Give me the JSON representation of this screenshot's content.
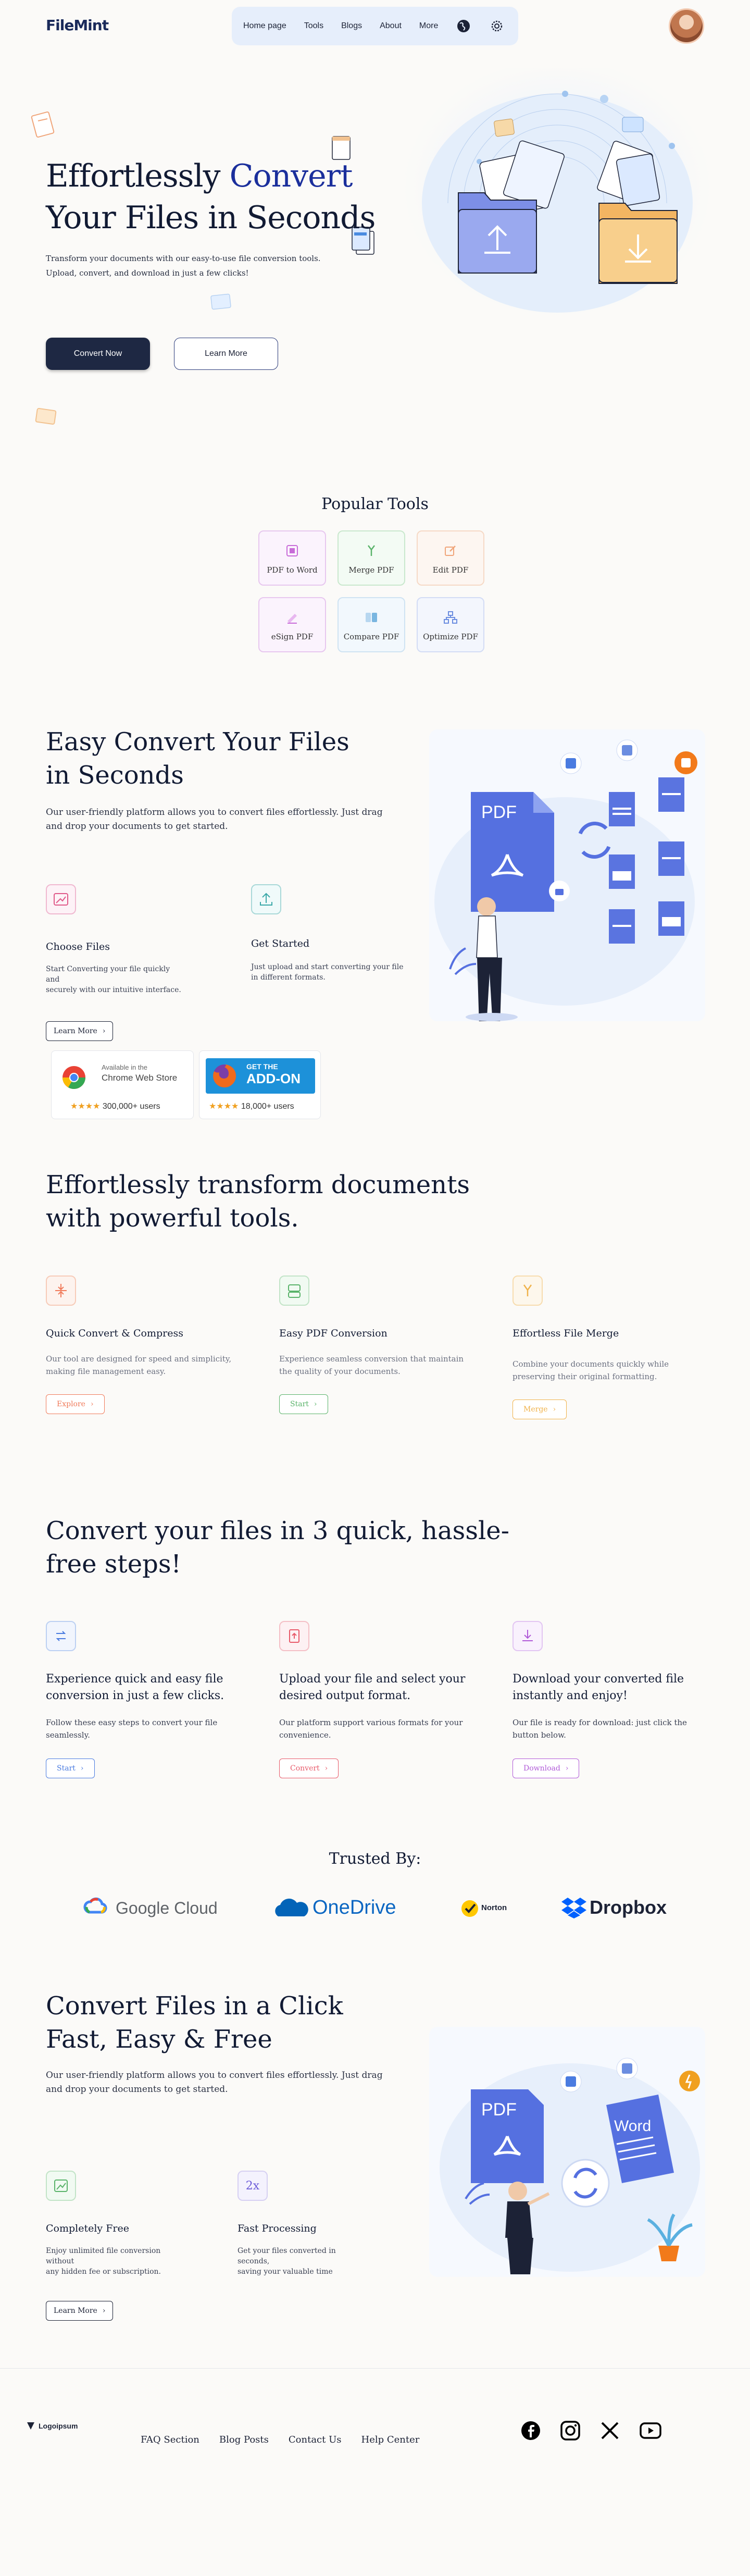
{
  "brand": {
    "name": "FileMint"
  },
  "nav": {
    "links": [
      "Home page",
      "Tools",
      "Blogs",
      "About",
      "More"
    ],
    "icons": [
      "globe-icon",
      "gear-icon"
    ]
  },
  "hero": {
    "title_line1_a": "Effortlessly ",
    "title_line1_b": "Convert",
    "title_line2": "Your Files in Seconds",
    "desc_line1": "Transform your documents with our easy-to-use file conversion tools.",
    "desc_line2": "Upload, convert, and download in just a few clicks!",
    "primary_button": "Convert Now",
    "secondary_button": "Learn More"
  },
  "popular_tools": {
    "title": "Popular Tools",
    "items": [
      {
        "label": "PDF to Word",
        "color": "#c86bd8"
      },
      {
        "label": "Merge PDF",
        "color": "#5ab36a"
      },
      {
        "label": "Edit PDF",
        "color": "#f0a57a"
      },
      {
        "label": "eSign PDF",
        "color": "#c86bd8"
      },
      {
        "label": "Compare PDF",
        "color": "#7ab6e0"
      },
      {
        "label": "Optimize PDF",
        "color": "#6b8de0"
      }
    ]
  },
  "easy_convert": {
    "title_line1": "Easy Convert Your Files",
    "title_line2": "in Seconds",
    "desc_line1": "Our user-friendly platform allows you to convert files effortlessly. Just drag",
    "desc_line2": "and drop your documents to get started.",
    "feature1": {
      "title": "Choose Files",
      "desc_line1": "Start Converting your file quickly",
      "desc_line2": "and",
      "desc_line3": "securely with our intuitive interface."
    },
    "feature2": {
      "title": "Get Started",
      "desc_line1": "Just upload and start converting your file",
      "desc_line2": "in different formats."
    },
    "learn_more": "Learn More",
    "chrome_badge": {
      "line1": "Available in the",
      "line2": "Chrome Web Store",
      "users": "300,000+ users"
    },
    "firefox_badge": {
      "line1": "GET THE",
      "line2": "ADD-ON",
      "users": "18,000+ users"
    },
    "illustration_label": "PDF"
  },
  "transform": {
    "title_line1": "Effortlessly transform documents",
    "title_line2": "with powerful tools.",
    "cards": [
      {
        "title": "Quick Convert & Compress",
        "desc_line1": "Our tool are designed for speed and simplicity,",
        "desc_line2": "making file management easy.",
        "button": "Explore",
        "color": "#f07a5a"
      },
      {
        "title": "Easy PDF Conversion",
        "desc_line1": "Experience seamless conversion that maintain",
        "desc_line2": "the quality of your documents.",
        "button": "Start",
        "color": "#5ab36a"
      },
      {
        "title": "Effortless File Merge",
        "desc_line1": "Combine your documents quickly while",
        "desc_line2": "preserving their original formatting.",
        "button": "Merge",
        "color": "#f0b24a"
      }
    ]
  },
  "steps": {
    "title_line1": "Convert your files in 3 quick, hassle-",
    "title_line2": "free steps!",
    "cards": [
      {
        "title_line1": "Experience quick and easy file",
        "title_line2": "conversion in just a few clicks.",
        "desc_line1": "Follow these easy steps to convert your file",
        "desc_line2": "seamlessly.",
        "button": "Start",
        "color": "#4a7be0"
      },
      {
        "title_line1": "Upload your file and select your",
        "title_line2": "desired output format.",
        "desc_line1": "Our platform support various formats for your",
        "desc_line2": "convenience.",
        "button": "Convert",
        "color": "#e85a6a"
      },
      {
        "title_line1": "Download your converted file",
        "title_line2": "instantly and enjoy!",
        "desc_line1": "Our file is ready for download: just click the",
        "desc_line2": "button below.",
        "button": "Download",
        "color": "#b05ad8"
      }
    ]
  },
  "trusted": {
    "title": "Trusted By:",
    "logos": [
      "Google Cloud",
      "OneDrive",
      "Norton",
      "Dropbox"
    ]
  },
  "click": {
    "title_line1": "Convert Files in a Click",
    "title_line2": "Fast, Easy & Free",
    "desc_line1": "Our user-friendly platform allows you to convert files effortlessly. Just drag",
    "desc_line2": "and drop your documents to get started.",
    "feature1": {
      "title": "Completely Free",
      "desc_line1": "Enjoy unlimited file conversion",
      "desc_line2": "without",
      "desc_line3": "any hidden fee or subscription."
    },
    "feature2": {
      "title": "Fast Processing",
      "badge": "2x",
      "desc_line1": "Get your files converted in",
      "desc_line2": "seconds,",
      "desc_line3": "saving your valuable time"
    },
    "learn_more": "Learn More",
    "illustration_pdf": "PDF",
    "illustration_word": "Word"
  },
  "footer": {
    "logo": "Logoipsum",
    "links": [
      "FAQ Section",
      "Blog Posts",
      "Contact Us",
      "Help Center"
    ],
    "social": [
      "facebook-icon",
      "instagram-icon",
      "x-icon",
      "youtube-icon"
    ]
  }
}
